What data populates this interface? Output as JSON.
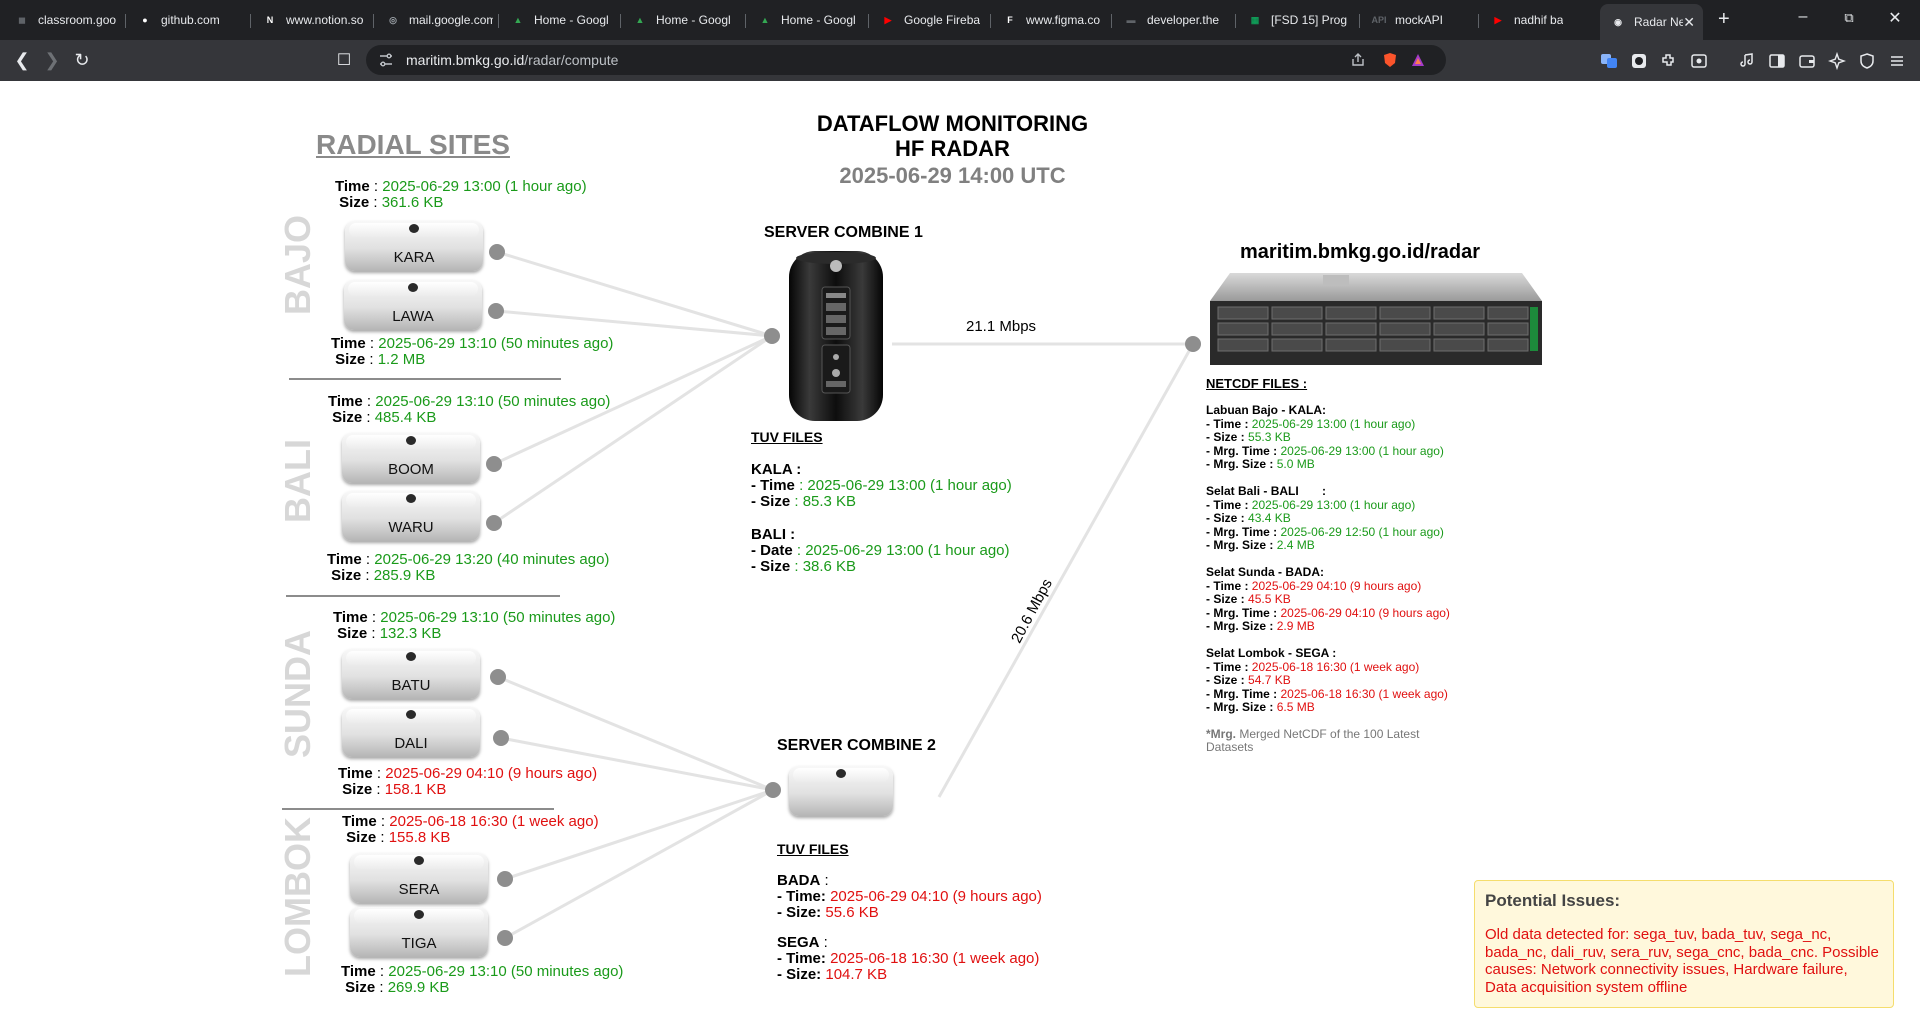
{
  "browser": {
    "tabs": [
      {
        "title": "classroom.goo",
        "icon": "classroom-icon",
        "color": "#5f6368"
      },
      {
        "title": "github.com",
        "icon": "github-icon",
        "color": "#ffffff"
      },
      {
        "title": "www.notion.so",
        "icon": "notion-icon",
        "color": "#ffffff"
      },
      {
        "title": "mail.google.com",
        "icon": "globe-icon",
        "color": "#9aa0a6"
      },
      {
        "title": "Home - Googl",
        "icon": "google-drive-icon",
        "color": "#34a853"
      },
      {
        "title": "Home - Googl",
        "icon": "google-drive-icon",
        "color": "#34a853"
      },
      {
        "title": "Home - Googl",
        "icon": "google-drive-icon",
        "color": "#34a853"
      },
      {
        "title": "Google Fireba",
        "icon": "youtube-icon",
        "color": "#ff0000"
      },
      {
        "title": "www.figma.co",
        "icon": "figma-icon",
        "color": "#ffffff"
      },
      {
        "title": "developer.the",
        "icon": "developer-icon",
        "color": "#5f6368"
      },
      {
        "title": "[FSD 15] Prog",
        "icon": "sheets-icon",
        "color": "#0f9d58"
      },
      {
        "title": "mockAPI",
        "icon": "api-icon",
        "color": "#5f6368"
      },
      {
        "title": "nadhif ba",
        "icon": "youtube-icon",
        "color": "#ff0000"
      },
      {
        "title": "Radar Ne",
        "icon": "radar-icon",
        "color": "#e8eaed"
      }
    ],
    "active_tab_close": "✕",
    "new_tab": "+",
    "url_host": "maritim.bmkg.go.id",
    "url_path": "/radar/compute"
  },
  "header": {
    "line1": "DATAFLOW MONITORING",
    "line2": "HF RADAR",
    "date": "2025-06-29 14:00 UTC"
  },
  "radial_title": "RADIAL SITES",
  "regions": {
    "bajo": {
      "name": "BAJO",
      "top_meta": {
        "time": "2025-06-29 13:00 (1 hour ago)",
        "size": "361.6 KB"
      },
      "sites": [
        "KARA",
        "LAWA"
      ],
      "bottom_meta": {
        "time": "2025-06-29 13:10 (50 minutes ago)",
        "size": "1.2 MB"
      }
    },
    "bali": {
      "name": "BALI",
      "top_meta": {
        "time": "2025-06-29 13:10 (50 minutes ago)",
        "size": "485.4 KB"
      },
      "sites": [
        "BOOM",
        "WARU"
      ],
      "bottom_meta": {
        "time": "2025-06-29 13:20 (40 minutes ago)",
        "size": "285.9 KB"
      }
    },
    "sunda": {
      "name": "SUNDA",
      "top_meta": {
        "time": "2025-06-29 13:10 (50 minutes ago)",
        "size": "132.3 KB"
      },
      "sites": [
        "BATU",
        "DALI"
      ],
      "bottom_meta": {
        "time": "2025-06-29 04:10 (9 hours ago)",
        "size": "158.1 KB"
      }
    },
    "lombok": {
      "name": "LOMBOK",
      "top_meta": {
        "time": "2025-06-18 16:30 (1 week ago)",
        "size": "155.8 KB"
      },
      "sites": [
        "SERA",
        "TIGA"
      ],
      "bottom_meta": {
        "time": "2025-06-29 13:10 (50 minutes ago)",
        "size": "269.9 KB"
      }
    }
  },
  "labels": {
    "time": "Time",
    "size": "Size",
    "sep": " : "
  },
  "server1": {
    "label": "SERVER COMBINE 1",
    "files_head": "TUV FILES",
    "kala": {
      "name": "KALA :",
      "k1": "- Time",
      "v1": " : 2025-06-29 13:00 (1 hour ago)",
      "k2": "- Size",
      "v2": " : 85.3 KB"
    },
    "bali": {
      "name": "BALI  :",
      "k1": "- Date",
      "v1": " : 2025-06-29 13:00 (1 hour ago)",
      "k2": "- Size",
      "v2": " : 38.6 KB"
    }
  },
  "server2": {
    "label": "SERVER COMBINE 2",
    "files_head": "TUV FILES",
    "bada": {
      "name": "BADA",
      "colon": " :",
      "k1": "- Time:",
      "v1": " 2025-06-29 04:10 (9 hours ago)",
      "k2": "- Size:",
      "v2": " 55.6 KB"
    },
    "sega": {
      "name": "SEGA",
      "colon": " :",
      "k1": "- Time:",
      "v1": " 2025-06-18 16:30 (1 week ago)",
      "k2": "- Size:",
      "v2": " 104.7 KB"
    }
  },
  "rates": {
    "s1": "21.1 Mbps",
    "s2": "20.6 Mbps"
  },
  "destination": {
    "title": "maritim.bmkg.go.id/radar",
    "nc_head": "NETCDF FILES :",
    "groups": [
      {
        "name": "Labuan Bajo - KALA:",
        "time": "2025-06-29 13:00 (1 hour ago)",
        "size": " 55.3 KB",
        "mtime": "2025-06-29 13:00 (1 hour ago)",
        "msize": " 5.0 MB",
        "status": "ok"
      },
      {
        "name": "Selat Bali - BALI       :",
        "time": "2025-06-29 13:00 (1 hour ago)",
        "size": " 43.4 KB",
        "mtime": "2025-06-29 12:50 (1 hour ago)",
        "msize": " 2.4 MB",
        "status": "ok"
      },
      {
        "name": "Selat Sunda - BADA:",
        "time": "2025-06-29 04:10 (9 hours ago)",
        "size": " 45.5 KB",
        "mtime": "2025-06-29 04:10 (9 hours ago)",
        "msize": " 2.9 MB",
        "status": "bad"
      },
      {
        "name": "Selat Lombok - SEGA :",
        "time": "2025-06-18 16:30 (1 week ago)",
        "size": " 54.7 KB",
        "mtime": "2025-06-18 16:30 (1 week ago)",
        "msize": " 6.5 MB",
        "status": "bad"
      }
    ],
    "keys": {
      "time": "- Time :",
      "size": "- Size :",
      "mtime": "- Mrg. Time :",
      "msize": "- Mrg. Size :"
    },
    "note_bold": "*Mrg.",
    "note_text": " Merged NetCDF of the 100 Latest Datasets"
  },
  "issues": {
    "title": "Potential Issues:",
    "body": "Old data detected for: sega_tuv, bada_tuv, sega_nc, bada_nc, dali_ruv, sera_ruv, sega_cnc, bada_cnc. Possible causes: Network connectivity issues, Hardware failure, Data acquisition system offline"
  },
  "colors": {
    "ok": "#1a9a1a",
    "bad": "#e01010",
    "line": "#e3e3e3",
    "region": "#d7d7d7"
  }
}
